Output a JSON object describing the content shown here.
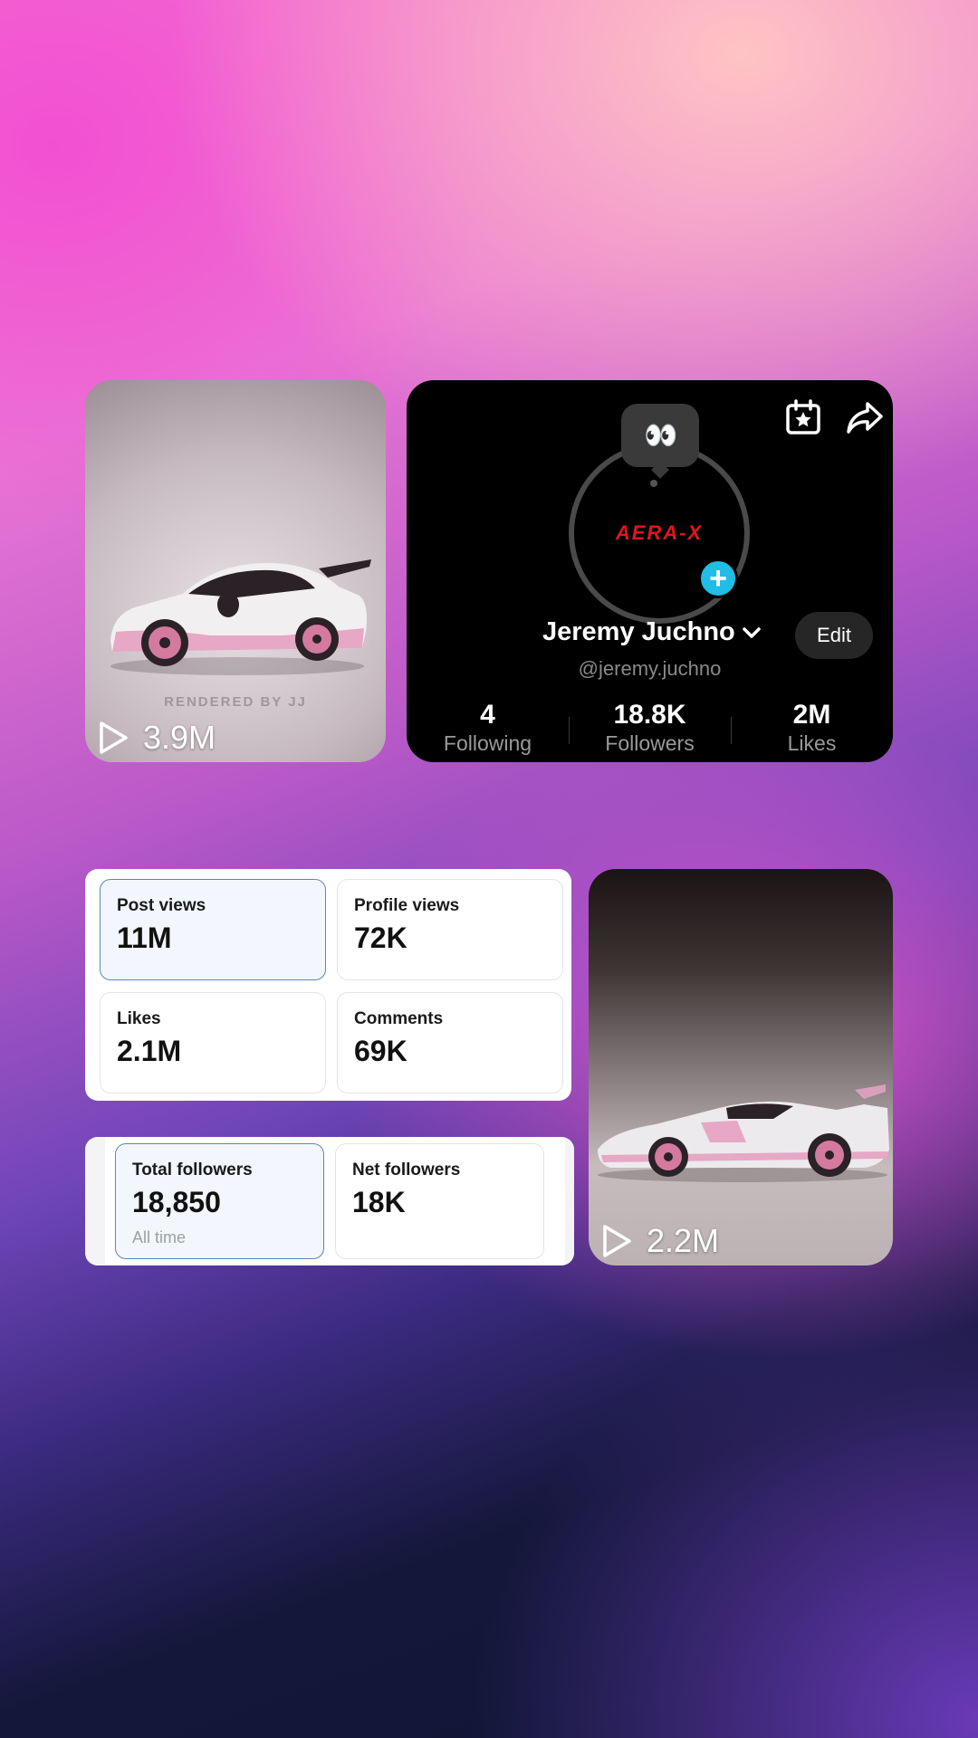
{
  "videos": [
    {
      "views": "3.9M",
      "watermark": "RENDERED BY JJ"
    },
    {
      "views": "2.2M"
    }
  ],
  "profile": {
    "name": "Jeremy Juchno",
    "handle": "@jeremy.juchno",
    "logo_text": "AERA-X",
    "status_emoji": "👀",
    "edit_label": "Edit",
    "stats": [
      {
        "value": "4",
        "label": "Following"
      },
      {
        "value": "18.8K",
        "label": "Followers"
      },
      {
        "value": "2M",
        "label": "Likes"
      }
    ],
    "icons": [
      "calendar-star-icon",
      "share-icon",
      "plus-icon",
      "chevron-down-icon"
    ]
  },
  "analytics": {
    "overview": [
      {
        "label": "Post views",
        "value": "11M",
        "selected": true
      },
      {
        "label": "Profile views",
        "value": "72K"
      },
      {
        "label": "Likes",
        "value": "2.1M"
      },
      {
        "label": "Comments",
        "value": "69K"
      }
    ],
    "followers": [
      {
        "label": "Total followers",
        "value": "18,850",
        "sub": "All time",
        "selected": true
      },
      {
        "label": "Net followers",
        "value": "18K"
      }
    ]
  },
  "colors": {
    "accent_plus": "#20bde6",
    "selected_border": "#5b86b8",
    "logo_red": "#e0161d"
  }
}
